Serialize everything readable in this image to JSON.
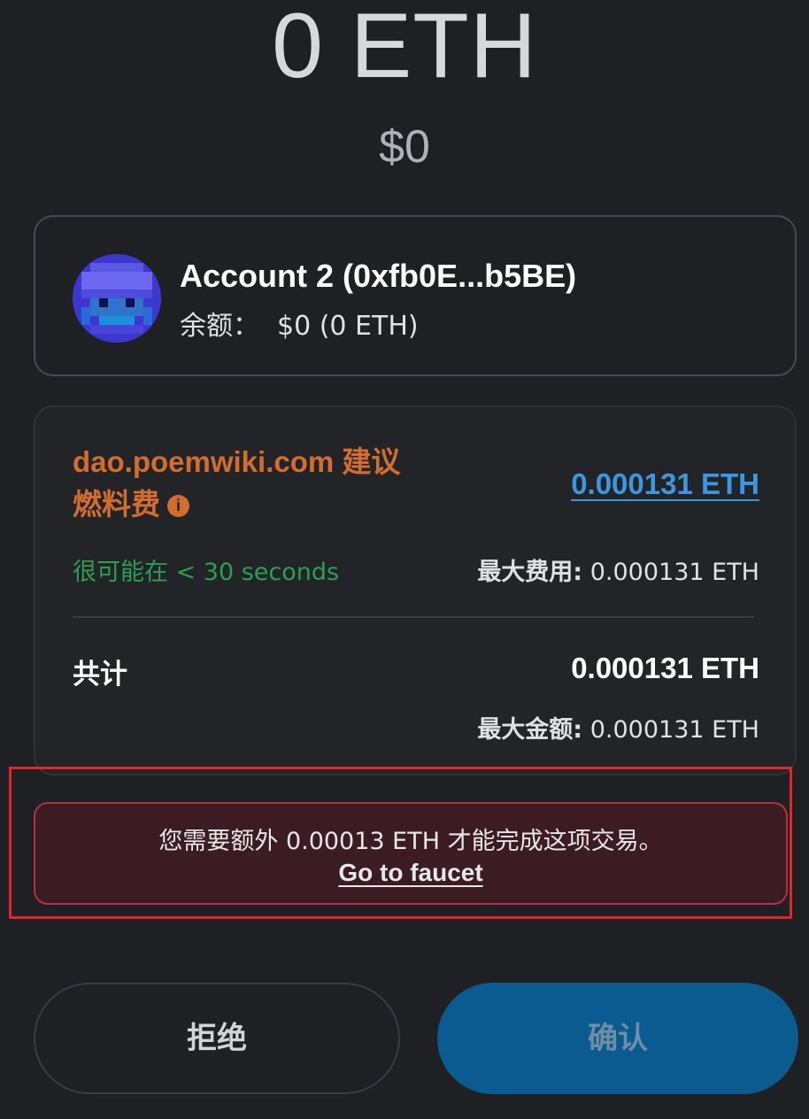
{
  "header": {
    "eth_amount": "0 ETH",
    "fiat_amount": "$0"
  },
  "account": {
    "name": "Account 2 (0xfb0E...b5BE)",
    "balance_label": "余额：",
    "balance_value": "$0 (0 ETH)",
    "avatar_icon": "pixel-avatar-icon"
  },
  "fee": {
    "site_label": "dao.poemwiki.com 建议燃料费",
    "info_icon": "i",
    "value": "0.000131 ETH",
    "eta": "很可能在 < 30 seconds",
    "max_fee_label": "最大费用:",
    "max_fee_value": "0.000131 ETH"
  },
  "total": {
    "label": "共计",
    "value": "0.000131 ETH",
    "max_label": "最大金额:",
    "max_value": "0.000131 ETH"
  },
  "warning": {
    "text": "您需要额外 0.00013 ETH 才能完成这项交易。",
    "link": "Go to faucet"
  },
  "actions": {
    "reject": "拒绝",
    "confirm": "确认"
  },
  "colors": {
    "background": "#1e2024",
    "accent_orange": "#d36c2f",
    "link_blue": "#3a97e0",
    "success_green": "#2d9e4f",
    "danger_border": "#b3323d",
    "highlight_red": "#e0262b",
    "confirm_blue": "#0b5b91"
  }
}
